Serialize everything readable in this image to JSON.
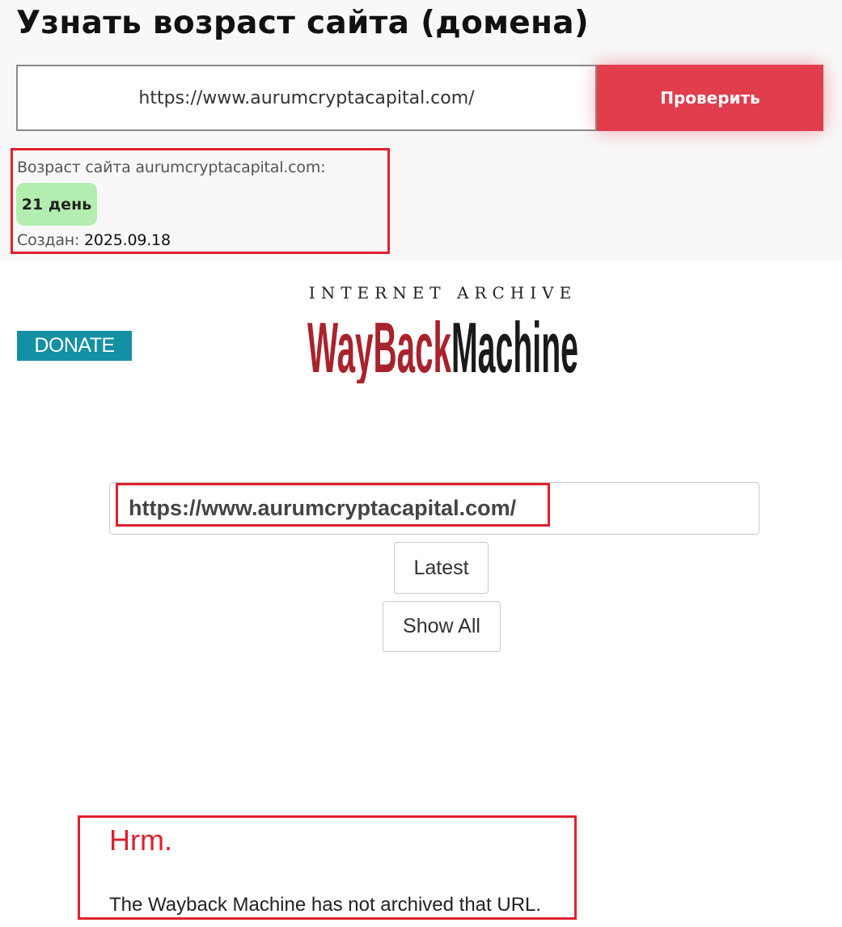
{
  "checker": {
    "title": "Узнать возраст сайта (домена)",
    "url_value": "https://www.aurumcryptacapital.com/",
    "check_button": "Проверить",
    "age_label": "Возраст сайта aurumcryptacapital.com:",
    "age_value": "21 день",
    "created_label": "Создан:",
    "created_date": "2025.09.18"
  },
  "wayback": {
    "donate_label": "DONATE",
    "logo_top": "INTERNET ARCHIVE",
    "logo_wayback": "WayBack",
    "logo_machine": "Machine",
    "url_value": "https://www.aurumcryptacapital.com/",
    "latest_button": "Latest",
    "show_all_button": "Show All",
    "heading": "Hrm.",
    "message": "The Wayback Machine has not archived that URL."
  },
  "colors": {
    "accent_red": "#e13d4d",
    "highlight_red": "#e0202e",
    "badge_green": "#b3eeb0",
    "donate_teal": "#1390a3",
    "logo_red": "#a8232b"
  }
}
